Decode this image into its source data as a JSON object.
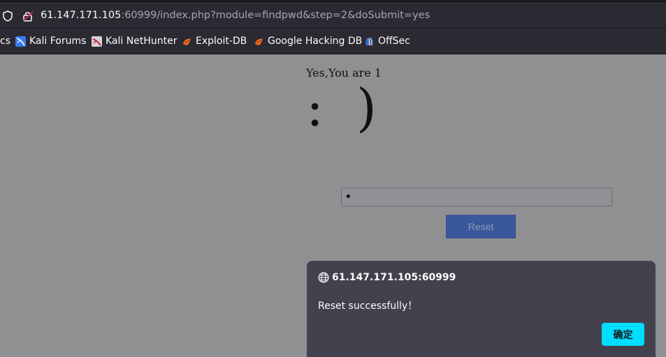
{
  "browser": {
    "url_host": "61.147.171.105",
    "url_rest": ":60999/index.php?module=findpwd&step=2&doSubmit=yes",
    "bookmarks": [
      {
        "label": "cs",
        "icon": "bookmark-icon"
      },
      {
        "label": "Kali Forums",
        "icon": "kali-icon"
      },
      {
        "label": "Kali NetHunter",
        "icon": "nethunter-icon"
      },
      {
        "label": "Exploit-DB",
        "icon": "exploitdb-icon"
      },
      {
        "label": "Google Hacking DB",
        "icon": "ghdb-icon"
      },
      {
        "label": "OffSec",
        "icon": "offsec-icon"
      }
    ]
  },
  "page": {
    "greeting": "Yes,You are 1",
    "smiley": ":  )",
    "password_value": "•",
    "reset_label": "Reset"
  },
  "dialog": {
    "origin": "61.147.171.105:60999",
    "message": "Reset successfully！",
    "ok_label": "确定"
  },
  "colors": {
    "page_bg": "#909093",
    "chrome_bg": "#2b2a33",
    "dialog_bg": "#42414d",
    "ok_button": "#00ddff",
    "reset_button": "#3b579b"
  }
}
